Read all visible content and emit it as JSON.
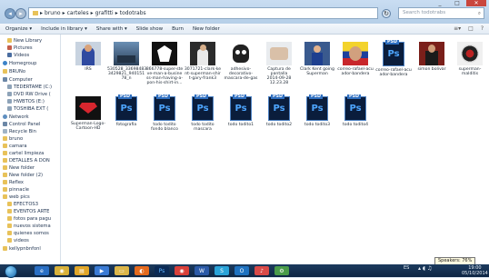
{
  "window": {
    "address_parts": [
      "▸",
      "bruno",
      "▸",
      "carteles",
      "▸",
      "grafitti",
      "▸",
      "todotrabs"
    ],
    "search_placeholder": "Search todotrabs",
    "controls": [
      "_",
      "□",
      "✕"
    ]
  },
  "toolbar": {
    "items": [
      "Organize ▾",
      "Include in library ▾",
      "Share with ▾",
      "Slide show",
      "Burn",
      "New folder"
    ],
    "right_icons": [
      "≡▾",
      "□",
      "?"
    ]
  },
  "sidebar": {
    "items": [
      {
        "label": "New Library",
        "icon": "folder-icon"
      },
      {
        "label": "Pictures",
        "icon": "pictures-icon"
      },
      {
        "label": "Videos",
        "icon": "videos-icon"
      },
      {
        "label": "Homegroup",
        "icon": "homegroup-icon"
      },
      {
        "label": "BRUNo",
        "icon": "user-icon"
      },
      {
        "label": "Computer",
        "icon": "computer-icon"
      },
      {
        "label": "TEDERTAME (C:)",
        "icon": "drive-icon"
      },
      {
        "label": "DVD RW Drive (",
        "icon": "dvd-icon"
      },
      {
        "label": "HWBTOS (E:)",
        "icon": "drive-icon"
      },
      {
        "label": "TOSHIBA EXT (",
        "icon": "drive-icon"
      },
      {
        "label": "Network",
        "icon": "network-icon"
      },
      {
        "label": "Control Panel",
        "icon": "control-panel-icon"
      },
      {
        "label": "Recycle Bin",
        "icon": "recycle-bin-icon"
      },
      {
        "label": "bruno",
        "icon": "folder-icon"
      },
      {
        "label": "camara",
        "icon": "folder-icon"
      },
      {
        "label": "cartel limpieza",
        "icon": "folder-icon"
      },
      {
        "label": "DETALLES A DON",
        "icon": "folder-icon"
      },
      {
        "label": "New folder",
        "icon": "folder-icon"
      },
      {
        "label": "New folder (2)",
        "icon": "folder-icon"
      },
      {
        "label": "Reflex",
        "icon": "folder-icon"
      },
      {
        "label": "pinnacle",
        "icon": "folder-icon"
      },
      {
        "label": "web pics",
        "icon": "folder-icon"
      },
      {
        "label": "EFECTOS3",
        "icon": "folder-icon"
      },
      {
        "label": "EVENTOS ARTE",
        "icon": "folder-icon"
      },
      {
        "label": "fotos para pagu",
        "icon": "folder-icon"
      },
      {
        "label": "nuevos sistema",
        "icon": "folder-icon"
      },
      {
        "label": "quienes somos",
        "icon": "folder-icon"
      },
      {
        "label": "videos",
        "icon": "folder-icon"
      },
      {
        "label": "kellypnbnfonl",
        "icon": "folder-icon"
      }
    ]
  },
  "files": {
    "row1": [
      {
        "name": "IRS",
        "kind": "photo-superman"
      },
      {
        "name": "530528_33698483\n3429821_940151\n78_n",
        "kind": "photo-city"
      },
      {
        "name": "866778-super-ste\nve-man-a-busine\nss-man-having-a-\npon-his-shirt-in...",
        "kind": "photo-superman-shirt"
      },
      {
        "name": "3071721-clark-ke\nnt-superman-shir\nt-gary-frank3",
        "kind": "photo-clark"
      },
      {
        "name": "adhesivo-\ndecorativo-\nmascara-de-gas",
        "kind": "photo-gasmask"
      },
      {
        "name": "Captura de\npantalla\n2014-09-28\n12.23.28",
        "kind": "photo-screenshot"
      },
      {
        "name": "Clark Kent going\nSuperman",
        "kind": "photo-clark2"
      },
      {
        "name": "correo-rafael-acu\nador-bandera",
        "kind": "photo-rafael"
      },
      {
        "name": "correo-rafael-acu\nador-bandera",
        "kind": "psd"
      },
      {
        "name": "simon bolivar",
        "kind": "photo-bolivar"
      },
      {
        "name": "superman-\nmalditis",
        "kind": "photo-superman-mad"
      }
    ],
    "row2": [
      {
        "name": "Superman-Logo-\nCartoon-HD",
        "kind": "photo-logo"
      },
      {
        "name": "fotografia",
        "kind": "psd"
      },
      {
        "name": "todo todito\nfondo blanco",
        "kind": "psd"
      },
      {
        "name": "todo todito\nmascara",
        "kind": "psd"
      },
      {
        "name": "todo todito1",
        "kind": "psd"
      },
      {
        "name": "todo todito2",
        "kind": "psd"
      },
      {
        "name": "todo todito3",
        "kind": "psd"
      },
      {
        "name": "todo todito4",
        "kind": "psd"
      }
    ],
    "psd_tag": "PSD",
    "ps_label": "Ps"
  },
  "taskbar": {
    "apps": [
      "start-orb",
      "ie-icon",
      "chrome-icon",
      "explorer-icon",
      "media-icon",
      "folder-icon",
      "firefox-icon",
      "photoshop-icon",
      "chrome2-icon",
      "word-icon",
      "skype-icon",
      "outlook-icon",
      "music-icon",
      "settings-icon"
    ],
    "tray_time": "19:00",
    "tray_date": "05/10/2014",
    "lang": "ES"
  },
  "tooltip": "Speakers: 76%"
}
